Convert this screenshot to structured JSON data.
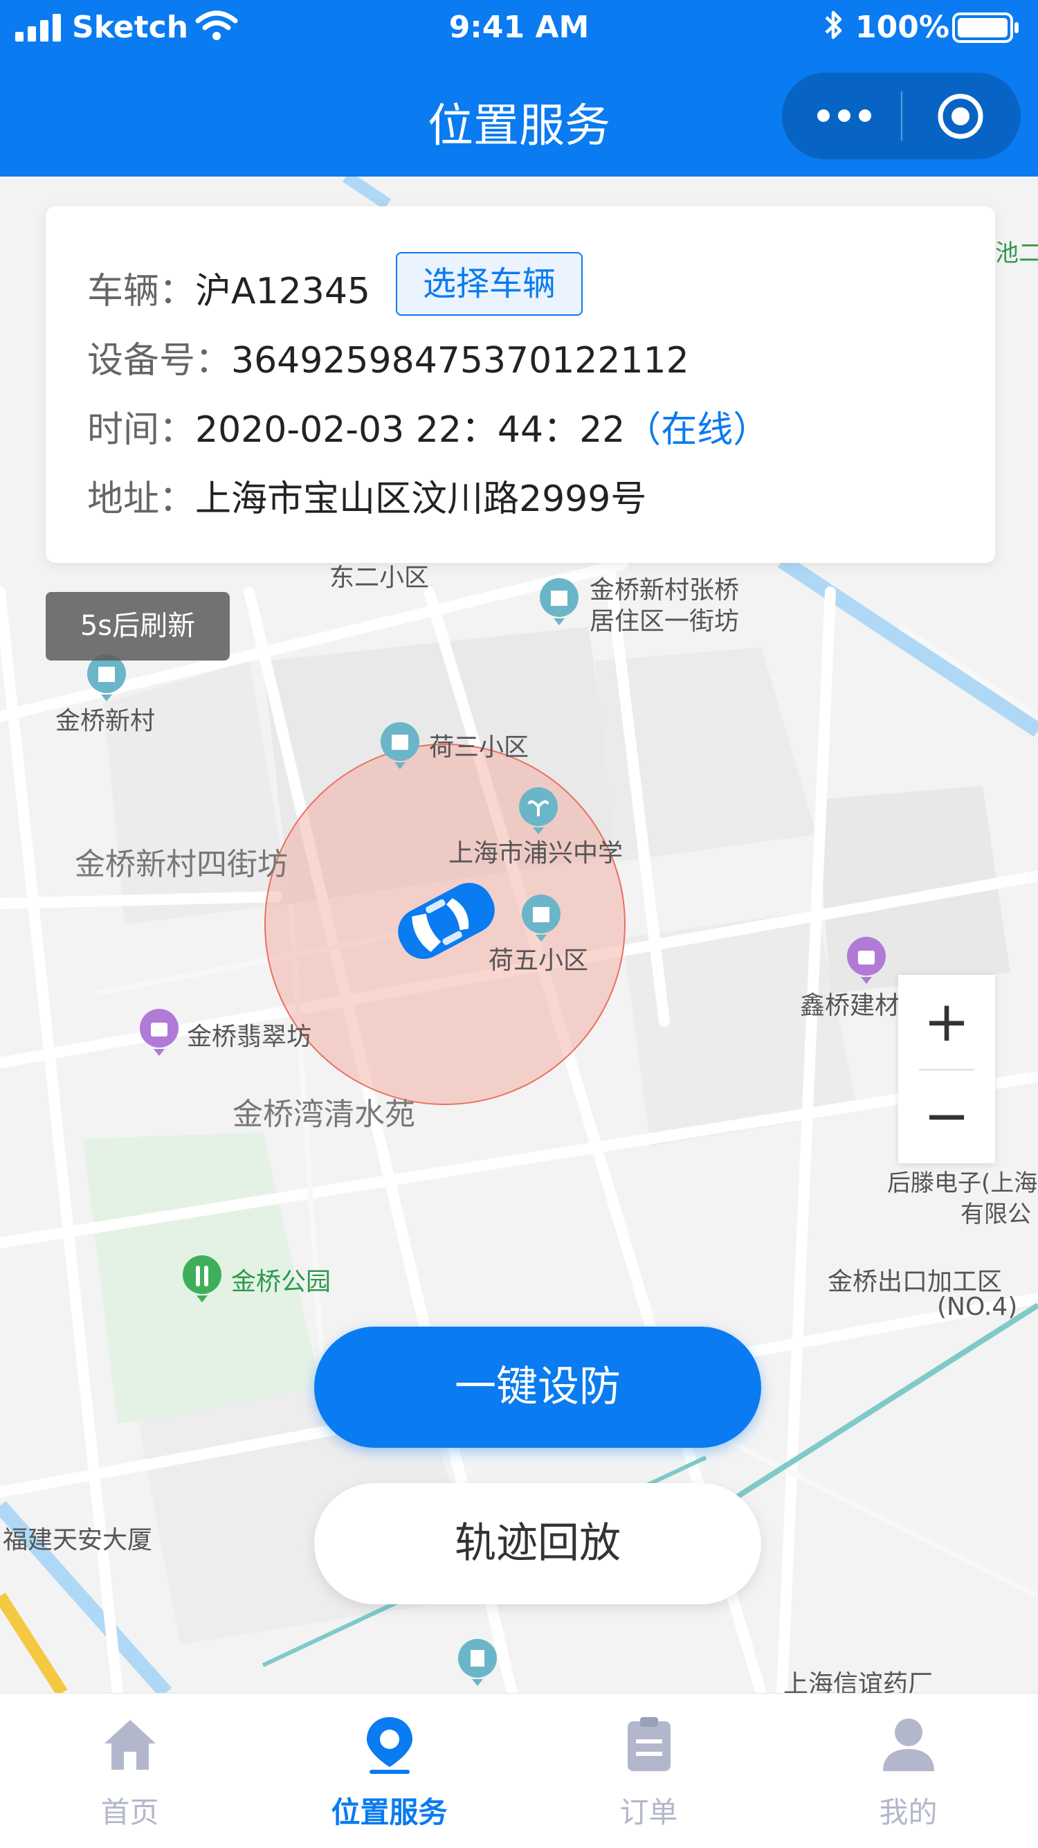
{
  "status_bar": {
    "carrier": "Sketch",
    "time": "9:41 AM",
    "battery": "100%"
  },
  "nav": {
    "title": "位置服务"
  },
  "vehicle_card": {
    "vehicle_label": "车辆：",
    "vehicle_plate": "沪A12345",
    "select_vehicle": "选择车辆",
    "device_label": "设备号：",
    "device_id": "364925984753701221​12",
    "time_label": "时间：",
    "time_value": "2020-02-03  22：44：22",
    "time_status": "（在线）",
    "address_label": "地址：",
    "address_value": "上海市宝山区汶川路2999号"
  },
  "refresh": {
    "label": "5s后刷新"
  },
  "map_labels": {
    "l1": "东二小区",
    "l2a": "金桥新村张桥",
    "l2b": "居住区一街坊",
    "l3": "金桥新村",
    "l4": "荷三小区",
    "l5": "上海市浦兴中学",
    "l6": "金桥新村四街坊",
    "l7": "荷五小区",
    "l8": "鑫桥建材",
    "l9": "金桥翡翠坊",
    "l10": "金桥湾清水苑",
    "l11a": "后滕电子(上海",
    "l11b": "有限公",
    "l12": "金桥公园",
    "l13a": "金桥出口加工区",
    "l13b": "(NO.4)",
    "l14": "福建天安大厦",
    "l15": "上海信谊药厂",
    "l16": "池二"
  },
  "zoom": {
    "in": "+",
    "out": "−"
  },
  "actions": {
    "arm": "一键设防",
    "playback": "轨迹回放"
  },
  "tabs": [
    {
      "label": "首页",
      "icon": "home-icon"
    },
    {
      "label": "位置服务",
      "icon": "location-icon"
    },
    {
      "label": "订单",
      "icon": "order-icon"
    },
    {
      "label": "我的",
      "icon": "user-icon"
    }
  ],
  "colors": {
    "primary": "#0a7bf0",
    "inactive": "#b3b7cc",
    "geofence": "#f4a59a"
  }
}
